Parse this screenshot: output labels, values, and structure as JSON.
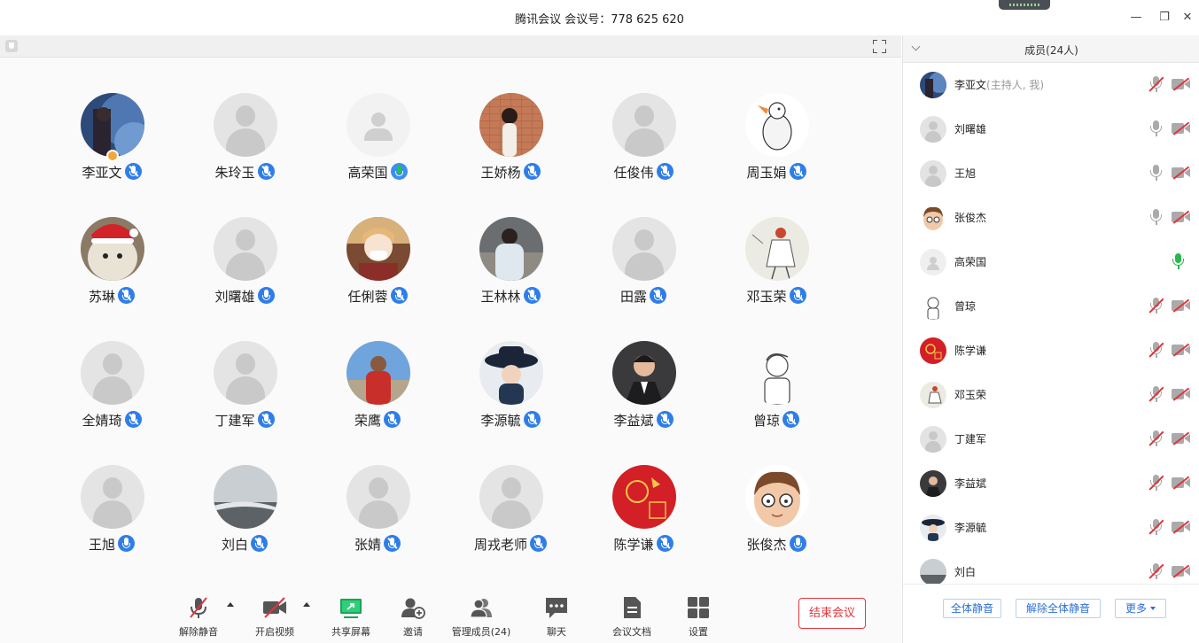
{
  "window": {
    "title": "腾讯会议 会议号：778 625 620"
  },
  "participants": [
    {
      "name": "李亚文",
      "mic": "active",
      "host": true
    },
    {
      "name": "朱玲玉",
      "mic": "active"
    },
    {
      "name": "高荣国",
      "mic": "speaking"
    },
    {
      "name": "王娇杨",
      "mic": "active"
    },
    {
      "name": "任俊伟",
      "mic": "active"
    },
    {
      "name": "周玉娟",
      "mic": "active"
    },
    {
      "name": "苏琳",
      "mic": "active"
    },
    {
      "name": "刘曙雄",
      "mic": "on"
    },
    {
      "name": "任俐蓉",
      "mic": "active"
    },
    {
      "name": "王林林",
      "mic": "active"
    },
    {
      "name": "田露",
      "mic": "active"
    },
    {
      "name": "邓玉荣",
      "mic": "active"
    },
    {
      "name": "全婧琦",
      "mic": "active"
    },
    {
      "name": "丁建军",
      "mic": "active"
    },
    {
      "name": "荣鹰",
      "mic": "active"
    },
    {
      "name": "李源毓",
      "mic": "active"
    },
    {
      "name": "李益斌",
      "mic": "active"
    },
    {
      "name": "曾琼",
      "mic": "active"
    },
    {
      "name": "王旭",
      "mic": "on"
    },
    {
      "name": "刘白",
      "mic": "active"
    },
    {
      "name": "张婧",
      "mic": "active"
    },
    {
      "name": "周戎老师",
      "mic": "active"
    },
    {
      "name": "陈学谦",
      "mic": "active"
    },
    {
      "name": "张俊杰",
      "mic": "on"
    }
  ],
  "toolbar": {
    "unmute": "解除静音",
    "start_video": "开启视频",
    "share_screen": "共享屏幕",
    "invite": "邀请",
    "manage_members": "管理成员(24)",
    "chat": "聊天",
    "meeting_docs": "会议文档",
    "settings": "设置",
    "end_meeting": "结束会议"
  },
  "panel": {
    "title": "成员(24人)",
    "members": [
      {
        "name": "李亚文",
        "role": "(主持人, 我)",
        "mic": "muted",
        "cam": "off"
      },
      {
        "name": "刘曙雄",
        "role": "",
        "mic": "on",
        "cam": "off"
      },
      {
        "name": "王旭",
        "role": "",
        "mic": "on",
        "cam": "off"
      },
      {
        "name": "张俊杰",
        "role": "",
        "mic": "on",
        "cam": "off"
      },
      {
        "name": "高荣国",
        "role": "",
        "mic": "speaking",
        "cam": "none"
      },
      {
        "name": "曾琼",
        "role": "",
        "mic": "muted",
        "cam": "off"
      },
      {
        "name": "陈学谦",
        "role": "",
        "mic": "muted",
        "cam": "off"
      },
      {
        "name": "邓玉荣",
        "role": "",
        "mic": "muted",
        "cam": "off"
      },
      {
        "name": "丁建军",
        "role": "",
        "mic": "muted",
        "cam": "off"
      },
      {
        "name": "李益斌",
        "role": "",
        "mic": "muted",
        "cam": "off"
      },
      {
        "name": "李源毓",
        "role": "",
        "mic": "muted",
        "cam": "off"
      },
      {
        "name": "刘白",
        "role": "",
        "mic": "muted",
        "cam": "off"
      }
    ],
    "mute_all": "全体静音",
    "unmute_all": "解除全体静音",
    "more": "更多"
  },
  "colors": {
    "accent_blue": "#2f7ee8",
    "end_red": "#e0353d",
    "speaking_green": "#2bb84a",
    "share_green": "#1aa35a"
  }
}
